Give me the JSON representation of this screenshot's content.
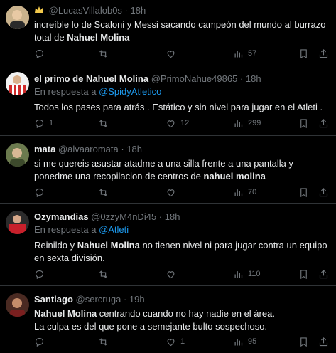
{
  "tweets": [
    {
      "display_name": "",
      "handle": "@LucasVillalob0s",
      "time": "18h",
      "reply_prefix": "",
      "reply_to": "",
      "text_parts": [
        "increíble lo de Scaloni y Messi sacando campeón del mundo al burrazo total de ",
        "Nahuel Molina",
        ""
      ],
      "counts": {
        "reply": "",
        "retweet": "",
        "like": "",
        "views": "57"
      }
    },
    {
      "display_name": "el primo de Nahuel Molina",
      "handle": "@PrimoNahue49865",
      "time": "18h",
      "reply_prefix": "En respuesta a ",
      "reply_to": "@SpidyAtletico",
      "text_parts": [
        "Todos los pases para atrás . Estático y sin nivel para jugar en el Atleti .",
        "",
        ""
      ],
      "counts": {
        "reply": "1",
        "retweet": "",
        "like": "12",
        "views": "299"
      }
    },
    {
      "display_name": "mata",
      "handle": "@alvaaromata",
      "time": "18h",
      "reply_prefix": "",
      "reply_to": "",
      "text_parts": [
        "si me quereis asustar atadme a una silla frente a una pantalla y ponedme una recopilacion de centros de ",
        "nahuel molina",
        ""
      ],
      "counts": {
        "reply": "",
        "retweet": "",
        "like": "",
        "views": "70"
      }
    },
    {
      "display_name": "Ozymandias",
      "handle": "@0zzyM4nDi45",
      "time": "18h",
      "reply_prefix": "En respuesta a ",
      "reply_to": "@Atleti",
      "text_parts": [
        "Reinildo y ",
        "Nahuel Molina",
        " no tienen nivel ni para jugar contra un equipo en sexta división."
      ],
      "counts": {
        "reply": "",
        "retweet": "",
        "like": "",
        "views": "110"
      }
    },
    {
      "display_name": "Santiago",
      "handle": "@sercruga",
      "time": "19h",
      "reply_prefix": "",
      "reply_to": "",
      "text_parts": [
        "",
        "Nahuel Molina",
        " centrando cuando no hay nadie en el área.\nLa culpa es del que pone a semejante bulto sospechoso."
      ],
      "counts": {
        "reply": "",
        "retweet": "",
        "like": "1",
        "views": "95"
      }
    }
  ],
  "colors": {
    "background": "#000000",
    "text": "#e7e9ea",
    "muted": "#71767b",
    "link": "#1d9bf0",
    "divider": "#2f3336"
  },
  "icons": [
    "reply-icon",
    "retweet-icon",
    "like-icon",
    "views-icon",
    "bookmark-icon",
    "share-icon"
  ]
}
